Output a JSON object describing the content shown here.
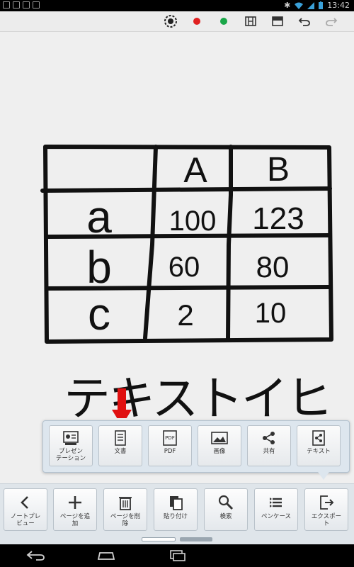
{
  "status_bar": {
    "time": "13:42"
  },
  "colors": {
    "pen_red": "#e02020",
    "pen_green": "#19a648",
    "annotation_arrow": "#e01010"
  },
  "toolbar": {
    "items": [
      {
        "icon": "pen-style-icon"
      },
      {
        "icon": "red-pen-icon"
      },
      {
        "icon": "green-pen-icon"
      },
      {
        "icon": "filmstrip-icon"
      },
      {
        "icon": "layout-icon"
      },
      {
        "icon": "undo-icon"
      },
      {
        "icon": "redo-icon"
      }
    ]
  },
  "canvas": {
    "table": {
      "header": [
        "",
        "A",
        "B"
      ],
      "rows": [
        [
          "a",
          "100",
          "123"
        ],
        [
          "b",
          "60",
          "80"
        ],
        [
          "c",
          "2",
          "10"
        ]
      ]
    },
    "handwritten_text": "テキストイヒ"
  },
  "export_menu": {
    "items": [
      {
        "label": "プレゼン\nテーション",
        "icon": "presentation-icon"
      },
      {
        "label": "文書",
        "icon": "document-icon"
      },
      {
        "label": "PDF",
        "icon": "pdf-icon",
        "badge": "PDF"
      },
      {
        "label": "画像",
        "icon": "image-icon"
      },
      {
        "label": "共有",
        "icon": "share-icon"
      },
      {
        "label": "テキスト",
        "icon": "text-share-icon"
      }
    ]
  },
  "bottom_bar": {
    "items": [
      {
        "label": "ノートプレ\nビュー",
        "icon": "back-chevron-icon"
      },
      {
        "label": "ページを追\n加",
        "icon": "plus-icon"
      },
      {
        "label": "ページを削\n除",
        "icon": "trash-icon"
      },
      {
        "label": "貼り付け",
        "icon": "paste-icon"
      },
      {
        "label": "検索",
        "icon": "search-icon"
      },
      {
        "label": "ペンケース",
        "icon": "pencase-icon"
      },
      {
        "label": "エクスポー\nト",
        "icon": "export-icon"
      }
    ]
  }
}
